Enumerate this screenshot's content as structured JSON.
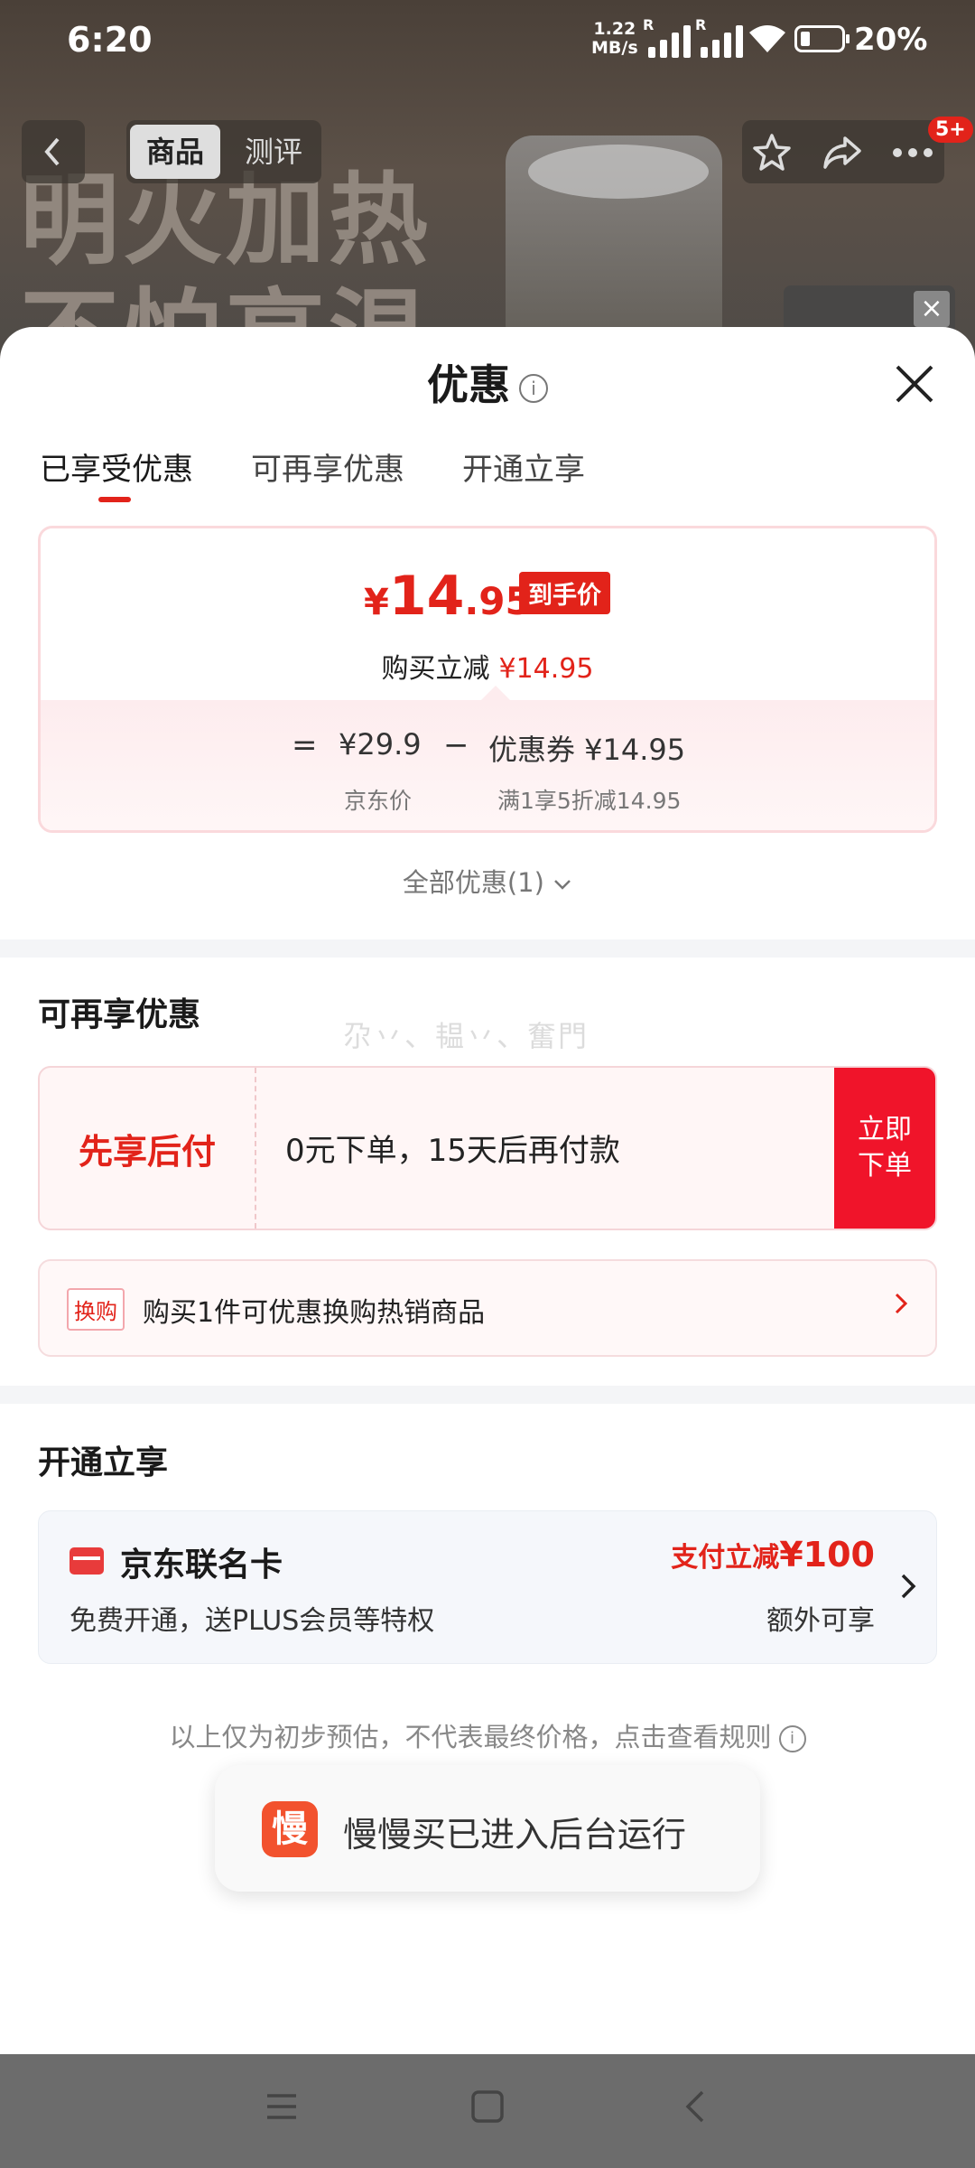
{
  "status_bar": {
    "time": "6:20",
    "speed_value": "1.22",
    "speed_unit": "MB/s",
    "sim1": "R",
    "sim2": "R",
    "battery": "20%"
  },
  "product_header": {
    "tab_goods": "商品",
    "tab_reviews": "测评",
    "badge": "5+",
    "banner_line1": "明火加热",
    "banner_line2": "不怕高温"
  },
  "sheet": {
    "title": "优惠",
    "tabs": [
      {
        "label": "已享受优惠",
        "active": true
      },
      {
        "label": "可再享优惠",
        "active": false
      },
      {
        "label": "开通立享",
        "active": false
      }
    ]
  },
  "price_card": {
    "currency": "¥",
    "price_int": "14",
    "price_dec": ".95",
    "price_tag": "到手价",
    "reduce_label": "购买立减",
    "reduce_value": "¥14.95",
    "eq": "=",
    "jd_price": "¥29.9",
    "minus": "−",
    "coupon": "优惠券 ¥14.95",
    "jd_price_label": "京东价",
    "coupon_label": "满1享5折减14.95"
  },
  "all_discounts": "全部优惠(1)",
  "more_section": {
    "title": "可再享优惠",
    "watermark": "尕丷、韫丷、奮門",
    "paylater": {
      "label": "先享后付",
      "desc": "0元下单，15天后再付款",
      "button": "立即下单"
    },
    "swap": {
      "tag": "换购",
      "text": "购买1件可优惠换购热销商品"
    }
  },
  "open_section": {
    "title": "开通立享",
    "card": {
      "name": "京东联名卡",
      "desc": "免费开通，送PLUS会员等特权",
      "benefit_prefix": "支付立减",
      "benefit_value": "¥100",
      "extra": "额外可享"
    }
  },
  "disclaimer": "以上仅为初步预估，不代表最终价格，点击查看规则",
  "toast": {
    "app_icon_text": "慢",
    "message": "慢慢买已进入后台运行"
  },
  "colors": {
    "accent": "#e2231a",
    "button_red": "#f0142a"
  }
}
